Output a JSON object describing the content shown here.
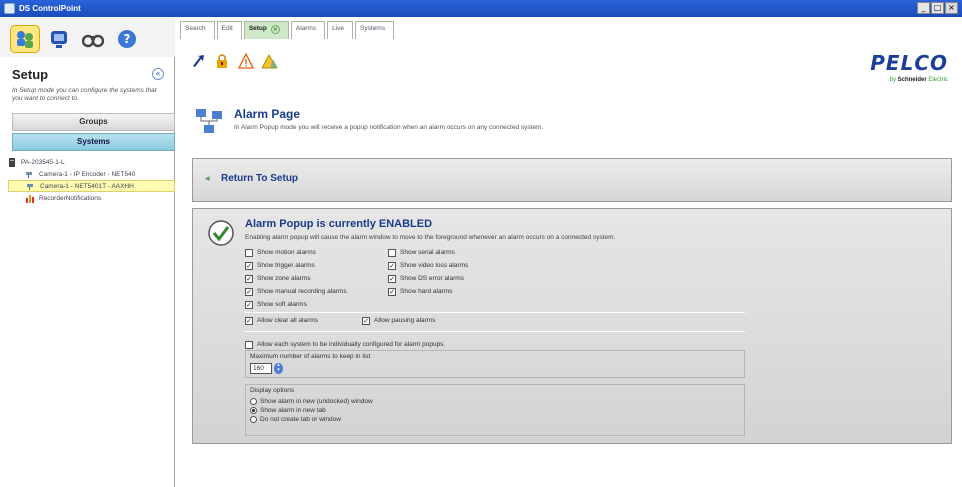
{
  "window": {
    "title": "DS ControlPoint",
    "minimize": "_",
    "maximize": "□",
    "close": "×"
  },
  "left": {
    "mode_icons": [
      "setup-icon",
      "monitor-icon",
      "binoculars-icon",
      "help-icon"
    ],
    "heading": "Setup",
    "collapse_glyph": "«",
    "description": "In Setup mode you can configure the systems that you want to connect to.",
    "groups_label": "Groups",
    "systems_label": "Systems",
    "tree": [
      {
        "label": "PA-203545-1-L",
        "level": 0,
        "icon": "server-icon"
      },
      {
        "label": "Camera-1 - IP Encoder - NET540",
        "level": 1,
        "icon": "camera-icon"
      },
      {
        "label": "Camera-1 - NET5401T - AAXHH",
        "level": 1,
        "icon": "camera-icon",
        "selected": true
      },
      {
        "label": "RecorderNotifications",
        "level": 1,
        "icon": "bar-chart-icon"
      }
    ]
  },
  "tabs": [
    {
      "label": "Search"
    },
    {
      "label": "Edit"
    },
    {
      "label": "Setup",
      "active": true,
      "close": "×"
    },
    {
      "label": "Alarms"
    },
    {
      "label": "Live"
    },
    {
      "label": "Systems"
    }
  ],
  "toolbar": [
    "arrow-icon",
    "lock-icon",
    "warning-icon",
    "warning-triangle-icon"
  ],
  "logo": {
    "brand": "PELCO",
    "by": "by",
    "company": "Schneider",
    "company2": "Electric"
  },
  "page": {
    "title": "Alarm Page",
    "description": "In Alarm Popup mode you will receive a popup notification when an alarm occurs on any connected system."
  },
  "return": {
    "label": "Return To Setup",
    "arrow": "◂"
  },
  "alarm": {
    "title": "Alarm Popup is currently ENABLED",
    "description": "Enabling alarm popup will cause the alarm window to move to the foreground whenever an alarm occurs on a connected system.",
    "col1": [
      {
        "label": "Show motion alarms",
        "checked": false
      },
      {
        "label": "Show trigger alarms",
        "checked": true
      },
      {
        "label": "Show zone alarms",
        "checked": true
      },
      {
        "label": "Show manual recording alarms",
        "checked": true
      },
      {
        "label": "Show soft alarms",
        "checked": true
      }
    ],
    "col2": [
      {
        "label": "Show serial alarms",
        "checked": false
      },
      {
        "label": "Show video loss alarms",
        "checked": true
      },
      {
        "label": "Show DS error alarms",
        "checked": true
      },
      {
        "label": "Show hard alarms",
        "checked": true
      }
    ],
    "allow_clear": {
      "label": "Allow clear all alarms",
      "checked": true
    },
    "allow_pausing": {
      "label": "Allow pausing alarms",
      "checked": true
    },
    "individual": {
      "label": "Allow each system to be individually configured for alarm popups.",
      "checked": false
    },
    "max_label": "Maximum number of alarms to keep in list",
    "max_value": "160",
    "display_title": "Display options",
    "display_options": [
      {
        "label": "Show alarm in new (undocked) window",
        "selected": false
      },
      {
        "label": "Show alarm in new tab",
        "selected": true
      },
      {
        "label": "Do not create tab or window",
        "selected": false
      }
    ]
  }
}
